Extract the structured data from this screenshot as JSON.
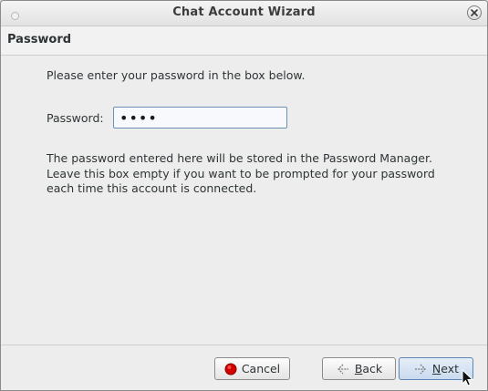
{
  "window": {
    "title": "Chat Account Wizard"
  },
  "page": {
    "header": "Password",
    "intro": "Please enter your password in the box below.",
    "password_label": "Password:",
    "password_value": "••••",
    "note_line1": "The password entered here will be stored in the Password Manager.",
    "note_line2": "Leave this box empty if you want to be prompted for your password",
    "note_line3": "each time this account is connected."
  },
  "buttons": {
    "cancel": "Cancel",
    "back": "Back",
    "next": "Next"
  },
  "colors": {
    "cancel_icon": "#d40000",
    "input_border": "#6e8fb4",
    "default_button": "#c9daef"
  },
  "icons": {
    "close": "close-icon",
    "cancel": "cancel-icon",
    "back": "back-arrow-icon",
    "next": "next-arrow-icon"
  }
}
